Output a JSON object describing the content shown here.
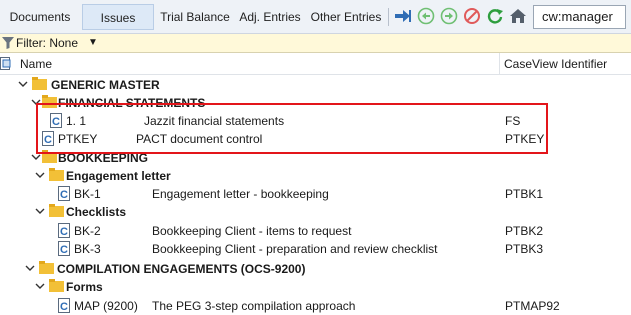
{
  "toolbar": {
    "tabs": [
      {
        "label": "Documents"
      },
      {
        "label": "Issues"
      },
      {
        "label": "Trial Balance"
      },
      {
        "label": "Adj. Entries"
      },
      {
        "label": "Other Entries"
      }
    ],
    "icons": [
      "jump-arrow-icon",
      "back-circle-icon",
      "forward-circle-icon",
      "no-entry-icon",
      "refresh-icon",
      "home-icon"
    ],
    "user": "cw:manager"
  },
  "filter": {
    "label": "Filter: None"
  },
  "columns": {
    "name": "Name",
    "identifier": "CaseView Identifier"
  },
  "tree": {
    "generic_master": {
      "label": "GENERIC MASTER"
    },
    "financial_statements": {
      "label": "FINANCIAL STATEMENTS"
    },
    "fs_doc": {
      "number": "1. 1",
      "title": "Jazzit financial statements",
      "id": "FS"
    },
    "ptkey_doc": {
      "number": "PTKEY",
      "title": "PACT document control",
      "id": "PTKEY"
    },
    "bookkeeping": {
      "label": "BOOKKEEPING"
    },
    "engagement_letter": {
      "label": "Engagement letter"
    },
    "bk1_doc": {
      "number": "BK-1",
      "title": "Engagement letter - bookkeeping",
      "id": "PTBK1"
    },
    "checklists": {
      "label": "Checklists"
    },
    "bk2_doc": {
      "number": "BK-2",
      "title": "Bookkeeping Client - items to request",
      "id": "PTBK2"
    },
    "bk3_doc": {
      "number": "BK-3",
      "title": "Bookkeeping Client - preparation and review checklist",
      "id": "PTBK3"
    },
    "compilation": {
      "label": "COMPILATION ENGAGEMENTS (OCS-9200)"
    },
    "forms": {
      "label": "Forms"
    },
    "map_doc": {
      "number": "MAP (9200)",
      "title": "The PEG 3-step compilation approach",
      "id": "PTMAP92"
    }
  },
  "colors": {
    "highlight": "#e3151a",
    "filter_bar": "#fff9d9",
    "active_tab": "#dde9f7",
    "folder": "#f2c037"
  }
}
